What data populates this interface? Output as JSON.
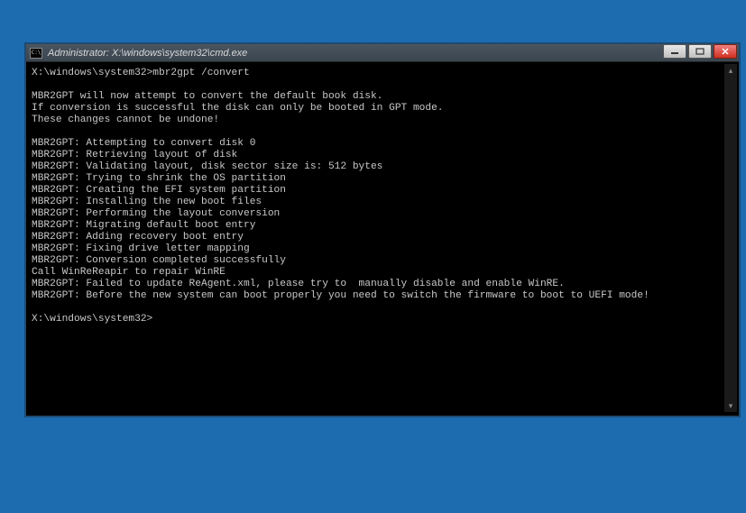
{
  "window": {
    "icon_label": "C:\\",
    "title": "Administrator: X:\\windows\\system32\\cmd.exe"
  },
  "terminal": {
    "prompt1": "X:\\windows\\system32>",
    "command1": "mbr2gpt /convert",
    "lines": [
      "",
      "MBR2GPT will now attempt to convert the default book disk.",
      "If conversion is successful the disk can only be booted in GPT mode.",
      "These changes cannot be undone!",
      "",
      "MBR2GPT: Attempting to convert disk 0",
      "MBR2GPT: Retrieving layout of disk",
      "MBR2GPT: Validating layout, disk sector size is: 512 bytes",
      "MBR2GPT: Trying to shrink the OS partition",
      "MBR2GPT: Creating the EFI system partition",
      "MBR2GPT: Installing the new boot files",
      "MBR2GPT: Performing the layout conversion",
      "MBR2GPT: Migrating default boot entry",
      "MBR2GPT: Adding recovery boot entry",
      "MBR2GPT: Fixing drive letter mapping",
      "MBR2GPT: Conversion completed successfully",
      "Call WinReReapir to repair WinRE",
      "MBR2GPT: Failed to update ReAgent.xml, please try to  manually disable and enable WinRE.",
      "MBR2GPT: Before the new system can boot properly you need to switch the firmware to boot to UEFI mode!",
      ""
    ],
    "prompt2": "X:\\windows\\system32>"
  },
  "scrollbar": {
    "up": "▴",
    "down": "▾"
  }
}
